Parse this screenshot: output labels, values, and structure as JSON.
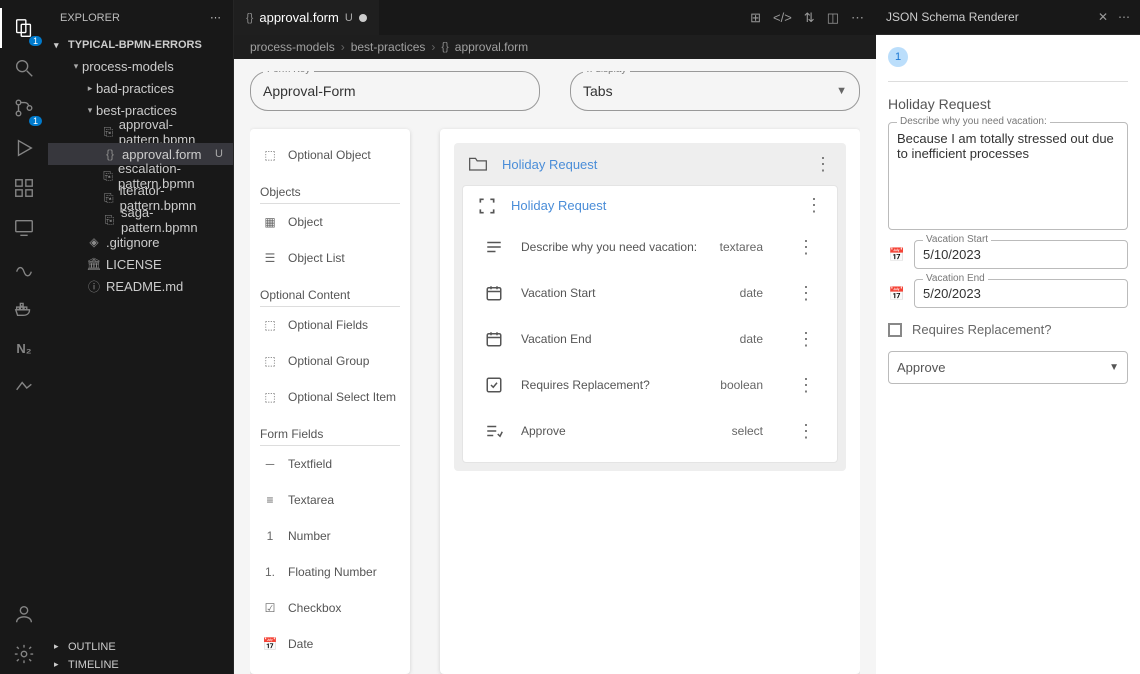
{
  "sidebar": {
    "title": "EXPLORER",
    "workspace": "TYPICAL-BPMN-ERRORS",
    "tree": {
      "root": "process-models",
      "folders": {
        "bad": "bad-practices",
        "best": "best-practices"
      },
      "files": {
        "approval_bpmn": "approval-pattern.bpmn",
        "approval_form": "approval.form",
        "escalation": "escalation-pattern.bpmn",
        "iterator": "iterator-pattern.bpmn",
        "saga": "saga-pattern.bpmn",
        "gitignore": ".gitignore",
        "license": "LICENSE",
        "readme": "README.md"
      },
      "modified_badge": "U"
    },
    "bottom": {
      "outline": "OUTLINE",
      "timeline": "TIMELINE"
    }
  },
  "activity": {
    "files_badge": "1",
    "scm_badge": "1"
  },
  "tabs": {
    "active": {
      "label": "approval.form",
      "status": "U"
    }
  },
  "breadcrumb": {
    "seg1": "process-models",
    "seg2": "best-practices",
    "seg3": "approval.form",
    "sep": "›"
  },
  "editor": {
    "formKeyLabel": "Form Key",
    "formKeyValue": "Approval-Form",
    "displayLabel": "x-display",
    "displayValue": "Tabs",
    "palette": {
      "item_optional_object": "Optional Object",
      "cat_objects": "Objects",
      "item_object": "Object",
      "item_object_list": "Object List",
      "cat_optional": "Optional Content",
      "item_opt_fields": "Optional Fields",
      "item_opt_group": "Optional Group",
      "item_opt_select": "Optional Select Item",
      "cat_fields": "Form Fields",
      "item_textfield": "Textfield",
      "item_textarea": "Textarea",
      "item_number": "Number",
      "item_float": "Floating Number",
      "item_checkbox": "Checkbox",
      "item_date": "Date"
    },
    "canvas": {
      "outer_title": "Holiday Request",
      "inner_title": "Holiday Request",
      "rows": {
        "desc": {
          "label": "Describe why you need vacation:",
          "type": "textarea"
        },
        "start": {
          "label": "Vacation Start",
          "type": "date"
        },
        "end": {
          "label": "Vacation End",
          "type": "date"
        },
        "replace": {
          "label": "Requires Replacement?",
          "type": "boolean"
        },
        "approve": {
          "label": "Approve",
          "type": "select"
        }
      }
    }
  },
  "side_panel": {
    "title": "JSON Schema Renderer",
    "step": "1",
    "section_title": "Holiday Request",
    "textarea_label": "Describe why you need vacation:",
    "textarea_value": "Because I am totally stressed out due to inefficient processes",
    "date1_label": "Vacation Start",
    "date1_value": "5/10/2023",
    "date2_label": "Vacation End",
    "date2_value": "5/20/2023",
    "checkbox_label": "Requires Replacement?",
    "select_value": "Approve"
  }
}
